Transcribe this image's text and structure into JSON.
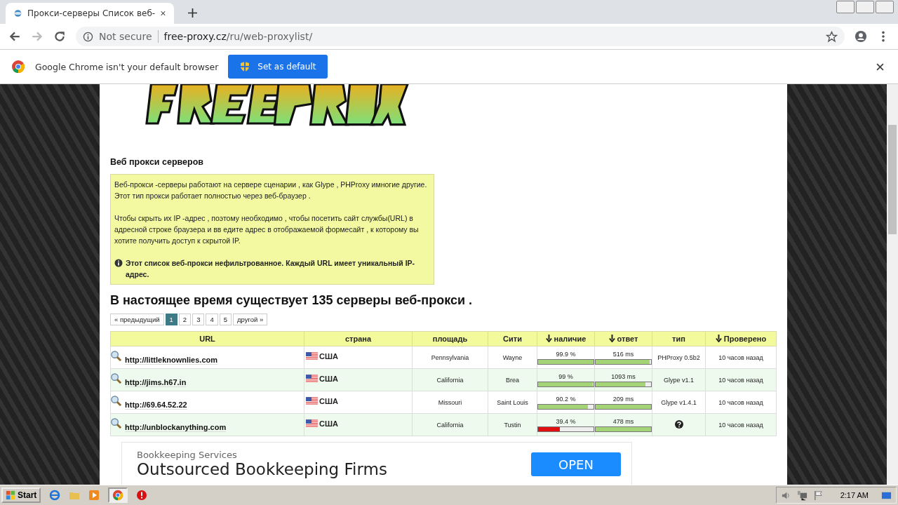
{
  "browser": {
    "tab_title": "Прокси-серверы Список веб-",
    "security": "Not secure",
    "url_host": "free-proxy.cz",
    "url_path": "/ru/web-proxylist/"
  },
  "infobar": {
    "message": "Google Chrome isn't your default browser",
    "button": "Set as default"
  },
  "page": {
    "section_title": "Веб прокси серверов",
    "info_paragraphs": [
      "Веб-прокси -серверы работают на сервере сценарии , как Glype , PHProxy имногие другие. Этот тип прокси работает полностью через веб-браузер .",
      "Чтобы скрыть их IP -адрес , поэтому необходимо , чтобы посетить сайт службы(URL) в адресной строке браузера и вв едите адрес в отображаемой формесайт , к которому вы хотите получить доступ к скрытой IP."
    ],
    "info_note": "Этот список веб-прокси нефильтрованное. Каждый URL имеет уникальный IP-адрес.",
    "count_heading": "В настоящее время существует 135 серверы веб-прокси .",
    "pagination": [
      {
        "label": "« предыдущий",
        "selected": false
      },
      {
        "label": "1",
        "selected": true
      },
      {
        "label": "2",
        "selected": false
      },
      {
        "label": "3",
        "selected": false
      },
      {
        "label": "4",
        "selected": false
      },
      {
        "label": "5",
        "selected": false
      },
      {
        "label": "другой »",
        "selected": false
      }
    ],
    "table": {
      "columns": [
        {
          "label": "URL",
          "sorted": false
        },
        {
          "label": "страна",
          "sorted": false
        },
        {
          "label": "площадь",
          "sorted": false
        },
        {
          "label": "Сити",
          "sorted": false
        },
        {
          "label": "наличие",
          "sorted": true
        },
        {
          "label": "ответ",
          "sorted": true
        },
        {
          "label": "тип",
          "sorted": false
        },
        {
          "label": "Проверено",
          "sorted": true
        }
      ],
      "rows": [
        {
          "url": "http://littleknownlies.com",
          "country": "США",
          "region": "Pennsylvania",
          "city": "Wayne",
          "availability": "99.9 %",
          "availability_bar": {
            "level": 0.999
          },
          "response": "516 ms",
          "response_bar": {
            "level": 0.97
          },
          "type": "PHProxy 0.5b2",
          "checked": "10 часов назад"
        },
        {
          "url": "http://jims.h67.in",
          "country": "США",
          "region": "California",
          "city": "Brea",
          "availability": "99 %",
          "availability_bar": {
            "level": 0.99
          },
          "response": "1093 ms",
          "response_bar": {
            "level": 0.9
          },
          "type": "Glype v1.1",
          "checked": "10 часов назад"
        },
        {
          "url": "http://69.64.52.22",
          "country": "США",
          "region": "Missouri",
          "city": "Saint Louis",
          "availability": "90.2 %",
          "availability_bar": {
            "level": 0.902
          },
          "response": "209 ms",
          "response_bar": {
            "level": 1
          },
          "type": "Glype v1.4.1",
          "checked": "10 часов назад"
        },
        {
          "url": "http://unblockanything.com",
          "country": "США",
          "region": "California",
          "city": "Tustin",
          "availability": "39.4 %",
          "availability_bar": {
            "level": 0.394
          },
          "response": "478 ms",
          "response_bar": {
            "level": 1
          },
          "checked": "10 часов назад"
        }
      ]
    },
    "ad": {
      "category": "Bookkeeping Services",
      "headline": "Outsourced Bookkeeping Firms",
      "button": "OPEN"
    }
  },
  "taskbar": {
    "start": "Start",
    "clock": "2:17 AM"
  }
}
